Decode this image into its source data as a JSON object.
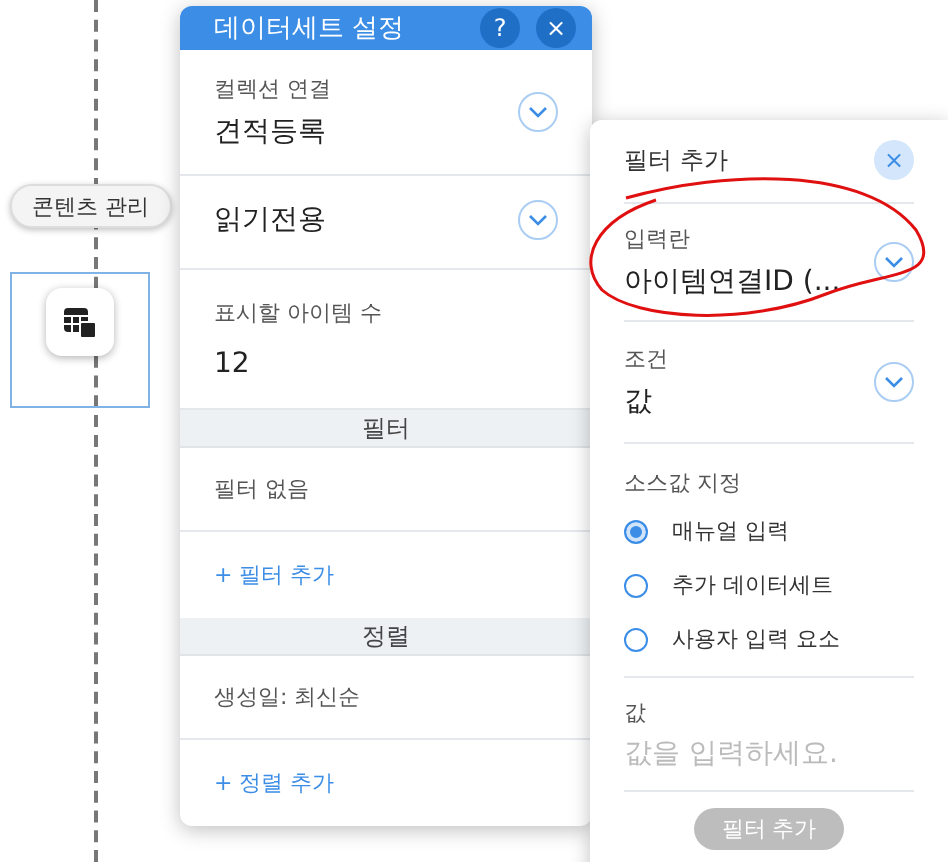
{
  "canvas": {
    "chips": [
      "콘텐츠 관리"
    ]
  },
  "dataset_panel": {
    "title": "데이터세트 설정",
    "help": "?",
    "close": "×",
    "collection": {
      "label": "컬렉션 연결",
      "value": "견적등록"
    },
    "mode": {
      "value": "읽기전용"
    },
    "items_count": {
      "label": "표시할 아이템 수",
      "value": "12"
    },
    "sections": [
      {
        "title": "필터",
        "item": "필터 없음",
        "add": "+ 필터 추가"
      },
      {
        "title": "정렬",
        "item": "생성일: 최신순",
        "add": "+ 정렬 추가"
      }
    ]
  },
  "filter_panel": {
    "title": "필터 추가",
    "close": "×",
    "field": {
      "label": "입력란",
      "value": "아이템연결ID (..."
    },
    "condition": {
      "label": "조건",
      "value": "값"
    },
    "source": {
      "label": "소스값 지정",
      "options": [
        {
          "label": "매뉴얼 입력",
          "selected": true
        },
        {
          "label": "추가 데이터세트",
          "selected": false
        },
        {
          "label": "사용자 입력 요소",
          "selected": false
        }
      ]
    },
    "value": {
      "label": "값",
      "placeholder": "값을 입력하세요."
    },
    "submit": {
      "label": "필터 추가",
      "disabled": true
    }
  }
}
